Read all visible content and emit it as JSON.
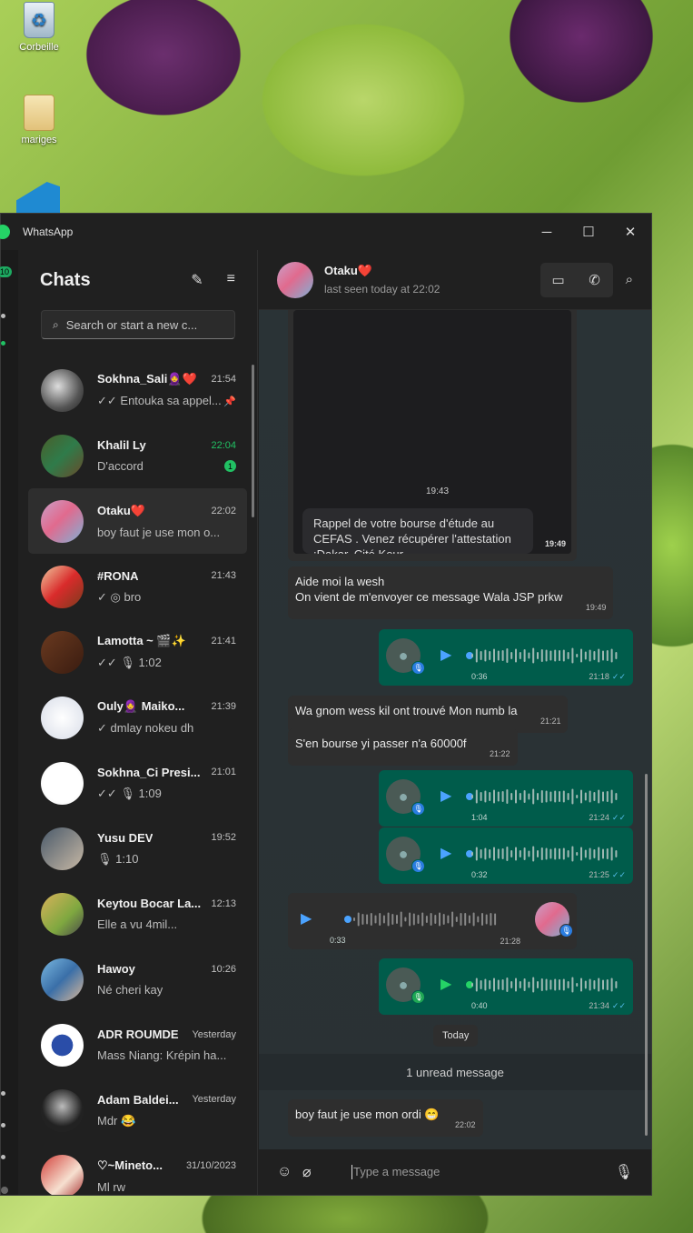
{
  "desktop": {
    "icons": [
      {
        "label": "Corbeille",
        "icon": "recycle-bin-icon"
      },
      {
        "label": "mariges",
        "icon": "folder-icon"
      }
    ]
  },
  "window": {
    "title": "WhatsApp",
    "controls": [
      "minimize",
      "maximize",
      "close"
    ]
  },
  "rail": {
    "badge": "10"
  },
  "sidebar": {
    "title": "Chats",
    "search_placeholder": "Search or start a new c...",
    "chats": [
      {
        "name": "Sokhna_Sali🧕❤️",
        "time": "21:54",
        "last": "✓✓ Entouka sa appel...",
        "pinned": true
      },
      {
        "name": "Khalil Ly",
        "time": "22:04",
        "last": "D'accord",
        "unread": "1"
      },
      {
        "name": "Otaku❤️",
        "time": "22:02",
        "last": "boy faut je use mon o...",
        "active": true
      },
      {
        "name": "#RONA",
        "time": "21:43",
        "last": "✓ ◎ bro"
      },
      {
        "name": "Lamotta ~ 🎬✨",
        "time": "21:41",
        "last": "✓✓ 🎙 1:02"
      },
      {
        "name": "Ouly🧕 Maiko...",
        "time": "21:39",
        "last": "✓ dmlay nokeu dh"
      },
      {
        "name": "Sokhna_Ci Presi...",
        "time": "21:01",
        "last": "✓✓ 🎙 1:09"
      },
      {
        "name": "Yusu DEV",
        "time": "19:52",
        "last": "🎙 1:10"
      },
      {
        "name": "Keytou Bocar La...",
        "time": "12:13",
        "last": "Elle a vu 4mil..."
      },
      {
        "name": "Hawoy",
        "time": "10:26",
        "last": "Né cheri kay"
      },
      {
        "name": "ADR ROUMDE",
        "time": "Yesterday",
        "last": "Mass Niang: Krépin ha..."
      },
      {
        "name": "Adam Baldei...",
        "time": "Yesterday",
        "last": "Mdr 😂"
      },
      {
        "name": "♡~Mineto...",
        "time": "31/10/2023",
        "last": "Ml rw"
      }
    ]
  },
  "conversation": {
    "name": "Otaku❤️",
    "status": "last seen today at 22:02",
    "image_message": {
      "inner_time": "19:43",
      "notification": "Rappel de votre bourse d'étude au CEFAS . Venez récupérer l'attestation :Dakar, Cité Keur",
      "time": "19:49"
    },
    "messages": [
      {
        "id": "m1",
        "dir": "in",
        "lines": [
          "Aide moi la wesh",
          "On vient de m'envoyer ce message Wala JSP prkw"
        ],
        "time": "19:49"
      },
      {
        "id": "v1",
        "dir": "out",
        "duration": "0:36",
        "time": "21:18",
        "ticks": "✓✓"
      },
      {
        "id": "m2",
        "dir": "in",
        "lines": [
          "Wa gnom wess kil ont trouvé Mon numb la"
        ],
        "time": "21:21"
      },
      {
        "id": "m3",
        "dir": "in",
        "lines": [
          "S'en bourse yi passer n'a 60000f"
        ],
        "time": "21:22"
      },
      {
        "id": "v2",
        "dir": "out",
        "duration": "1:04",
        "time": "21:24",
        "ticks": "✓✓"
      },
      {
        "id": "v3",
        "dir": "out",
        "duration": "0:32",
        "time": "21:25",
        "ticks": "✓✓"
      },
      {
        "id": "v4",
        "dir": "in",
        "duration": "0:33",
        "time": "21:28"
      },
      {
        "id": "v5",
        "dir": "out",
        "duration": "0:40",
        "time": "21:34",
        "ticks": "✓✓",
        "played": true
      }
    ],
    "date_chip": "Today",
    "unread_divider": "1 unread message",
    "last_message": {
      "text": "boy faut je use mon ordi 😁",
      "time": "22:02"
    },
    "composer_placeholder": "Type a message"
  }
}
